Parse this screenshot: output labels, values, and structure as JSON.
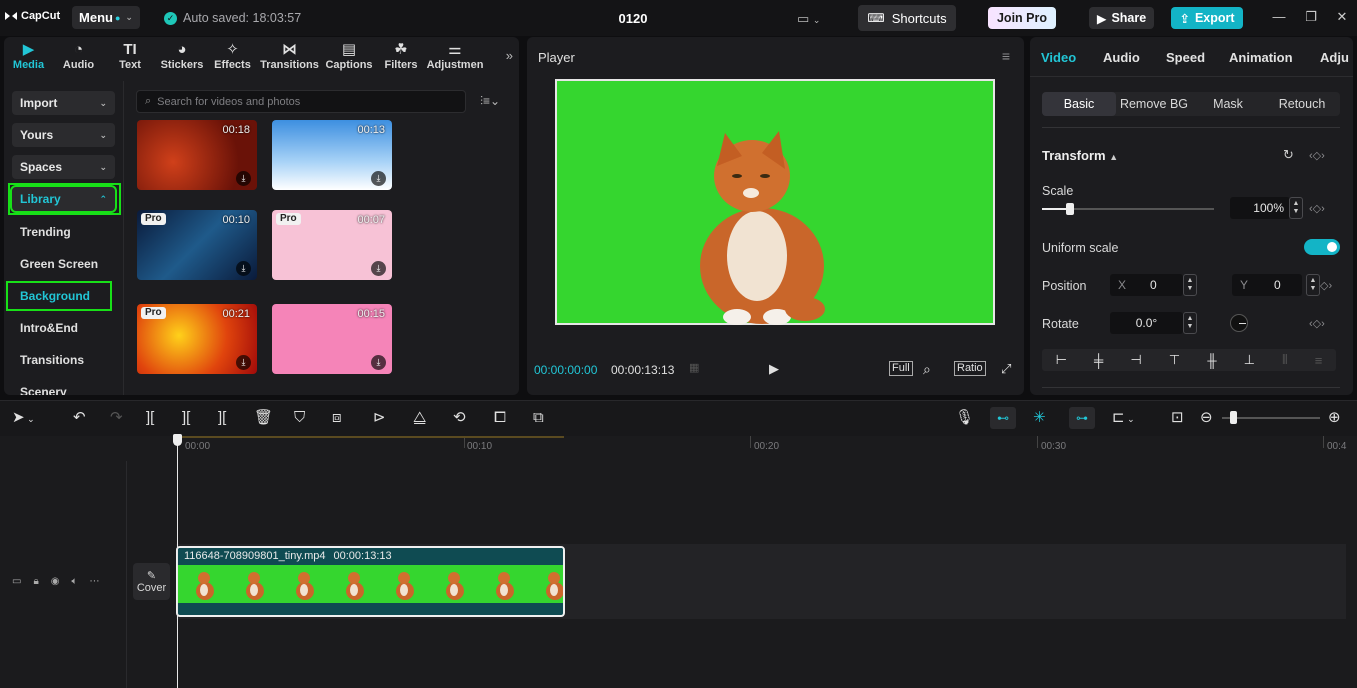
{
  "app": {
    "logo": "CapCut",
    "menu_label": "Menu",
    "autosave": "Auto saved: 18:03:57",
    "project_title": "0120"
  },
  "topbar": {
    "shortcuts": "Shortcuts",
    "join_pro": "Join Pro",
    "share": "Share",
    "export": "Export"
  },
  "media_tabs": [
    {
      "label": "Media",
      "icon": "media-icon"
    },
    {
      "label": "Audio",
      "icon": "audio-icon"
    },
    {
      "label": "Text",
      "icon": "text-icon"
    },
    {
      "label": "Stickers",
      "icon": "stickers-icon"
    },
    {
      "label": "Effects",
      "icon": "effects-icon"
    },
    {
      "label": "Transitions",
      "icon": "transitions-icon"
    },
    {
      "label": "Captions",
      "icon": "captions-icon"
    },
    {
      "label": "Filters",
      "icon": "filters-icon"
    },
    {
      "label": "Adjustmen",
      "icon": "adjustment-icon"
    }
  ],
  "sidebar": {
    "import": "Import",
    "yours": "Yours",
    "spaces": "Spaces",
    "library": "Library",
    "items": [
      "Trending",
      "Green Screen",
      "Background",
      "Intro&End",
      "Transitions",
      "Scenery"
    ]
  },
  "search": {
    "placeholder": "Search for videos and photos"
  },
  "thumbnails": [
    {
      "duration": "00:18",
      "pro": ""
    },
    {
      "duration": "00:13",
      "pro": ""
    },
    {
      "duration": "00:10",
      "pro": "Pro"
    },
    {
      "duration": "00:07",
      "pro": "Pro"
    },
    {
      "duration": "00:21",
      "pro": "Pro"
    },
    {
      "duration": "00:15",
      "pro": ""
    }
  ],
  "player": {
    "title": "Player",
    "current_time": "00:00:00:00",
    "duration": "00:00:13:13",
    "full": "Full",
    "ratio": "Ratio"
  },
  "props": {
    "tabs": [
      "Video",
      "Audio",
      "Speed",
      "Animation",
      "Adju"
    ],
    "subtabs": [
      "Basic",
      "Remove BG",
      "Mask",
      "Retouch"
    ],
    "transform_title": "Transform",
    "scale_label": "Scale",
    "scale_value": "100%",
    "scale_level": 0.16,
    "uniform_scale": "Uniform scale",
    "position_label": "Position",
    "pos_x_label": "X",
    "pos_x": "0",
    "pos_y_label": "Y",
    "pos_y": "0",
    "rotate_label": "Rotate",
    "rotate_value": "0.0°"
  },
  "timeline": {
    "ruler": [
      "00:00",
      "00:10",
      "00:20",
      "00:30",
      "00:4"
    ],
    "clip_name": "116648-708909801_tiny.mp4",
    "clip_duration": "00:00:13:13",
    "cover_label": "Cover"
  },
  "colors": {
    "accent": "#22c6d6",
    "highlight": "#18e018",
    "greenscreen": "#35d62f"
  }
}
